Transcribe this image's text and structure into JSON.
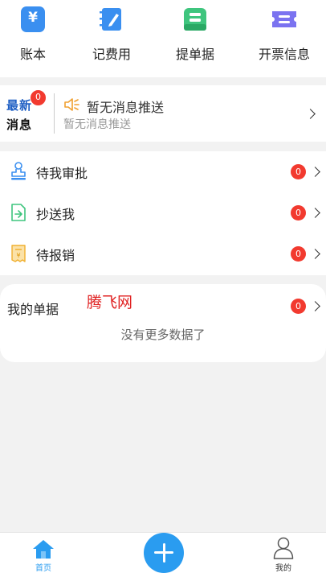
{
  "quick_actions": [
    {
      "label": "账本",
      "icon": "ledger-yen-icon",
      "color": "#3a8ff0",
      "glyph": "¥"
    },
    {
      "label": "记费用",
      "icon": "expense-notebook-icon",
      "color": "#3a8ff0"
    },
    {
      "label": "提单据",
      "icon": "submit-document-icon",
      "color": "#3fc57e"
    },
    {
      "label": "开票信息",
      "icon": "invoice-ticket-icon",
      "color": "#7b73f0"
    }
  ],
  "news": {
    "logo_line1": "最新",
    "logo_line2": "消息",
    "badge": "0",
    "title": "暂无消息推送",
    "subtitle": "暂无消息推送"
  },
  "tasks": [
    {
      "label": "待我审批",
      "badge": "0",
      "icon": "approval-stamp-icon"
    },
    {
      "label": "抄送我",
      "badge": "0",
      "icon": "cc-forward-icon"
    },
    {
      "label": "待报销",
      "badge": "0",
      "icon": "reimburse-receipt-icon"
    }
  ],
  "my_documents": {
    "title": "我的单据",
    "watermark": "腾飞网",
    "badge": "0",
    "empty_text": "没有更多数据了"
  },
  "tabbar": {
    "home": {
      "label": "首页",
      "icon": "home-icon"
    },
    "add": {
      "icon": "plus-icon"
    },
    "mine": {
      "label": "我的",
      "icon": "user-icon"
    }
  },
  "colors": {
    "accent": "#2a9cf0",
    "badge": "#f23a2f"
  }
}
